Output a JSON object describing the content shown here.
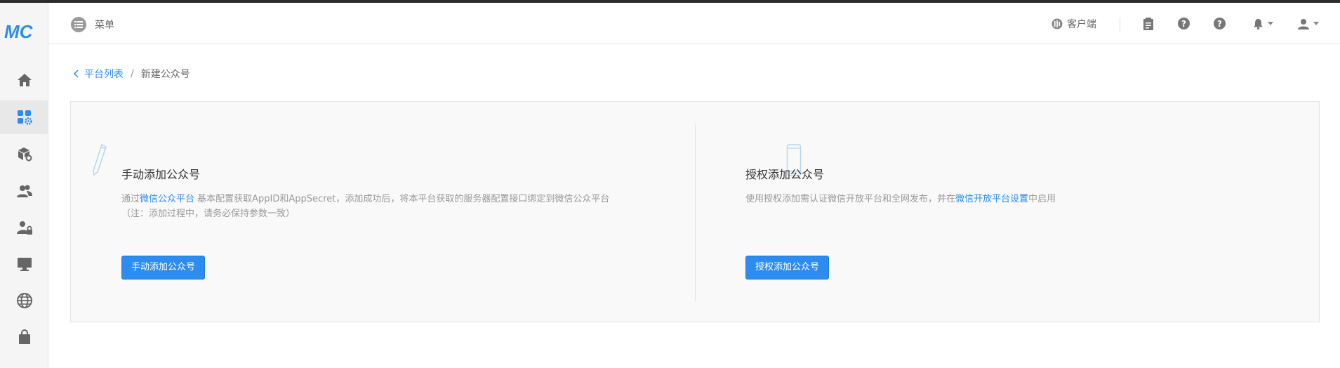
{
  "logo": {
    "text": "MC"
  },
  "sidebar": {
    "items": [
      {
        "icon": "home-icon"
      },
      {
        "icon": "apps-gear-icon",
        "active": true
      },
      {
        "icon": "box-gear-icon"
      },
      {
        "icon": "users-icon"
      },
      {
        "icon": "user-lock-icon"
      },
      {
        "icon": "monitor-icon"
      },
      {
        "icon": "globe-icon"
      },
      {
        "icon": "shopping-bag-icon"
      }
    ]
  },
  "header": {
    "menu_label": "菜单",
    "client_label": "客户端"
  },
  "breadcrumb": {
    "parent": "平台列表",
    "separator": "/",
    "current": "新建公众号"
  },
  "manual": {
    "title": "手动添加公众号",
    "desc_prefix": "通过",
    "desc_link": "微信公众平台",
    "desc_suffix": " 基本配置获取AppID和AppSecret，添加成功后，将本平台获取的服务器配置接口绑定到微信公众平台",
    "desc_note": "（注：添加过程中，请务必保持参数一致）",
    "button": "手动添加公众号"
  },
  "authorize": {
    "title": "授权添加公众号",
    "desc_prefix": "使用授权添加需认证微信开放平台和全网发布，并在",
    "desc_link": "微信开放平台设置",
    "desc_suffix": "中启用",
    "button": "授权添加公众号"
  },
  "colors": {
    "accent": "#2d8cf0",
    "sidebar_bg": "#f5f5f5",
    "panel_bg": "#f9f9f9"
  }
}
